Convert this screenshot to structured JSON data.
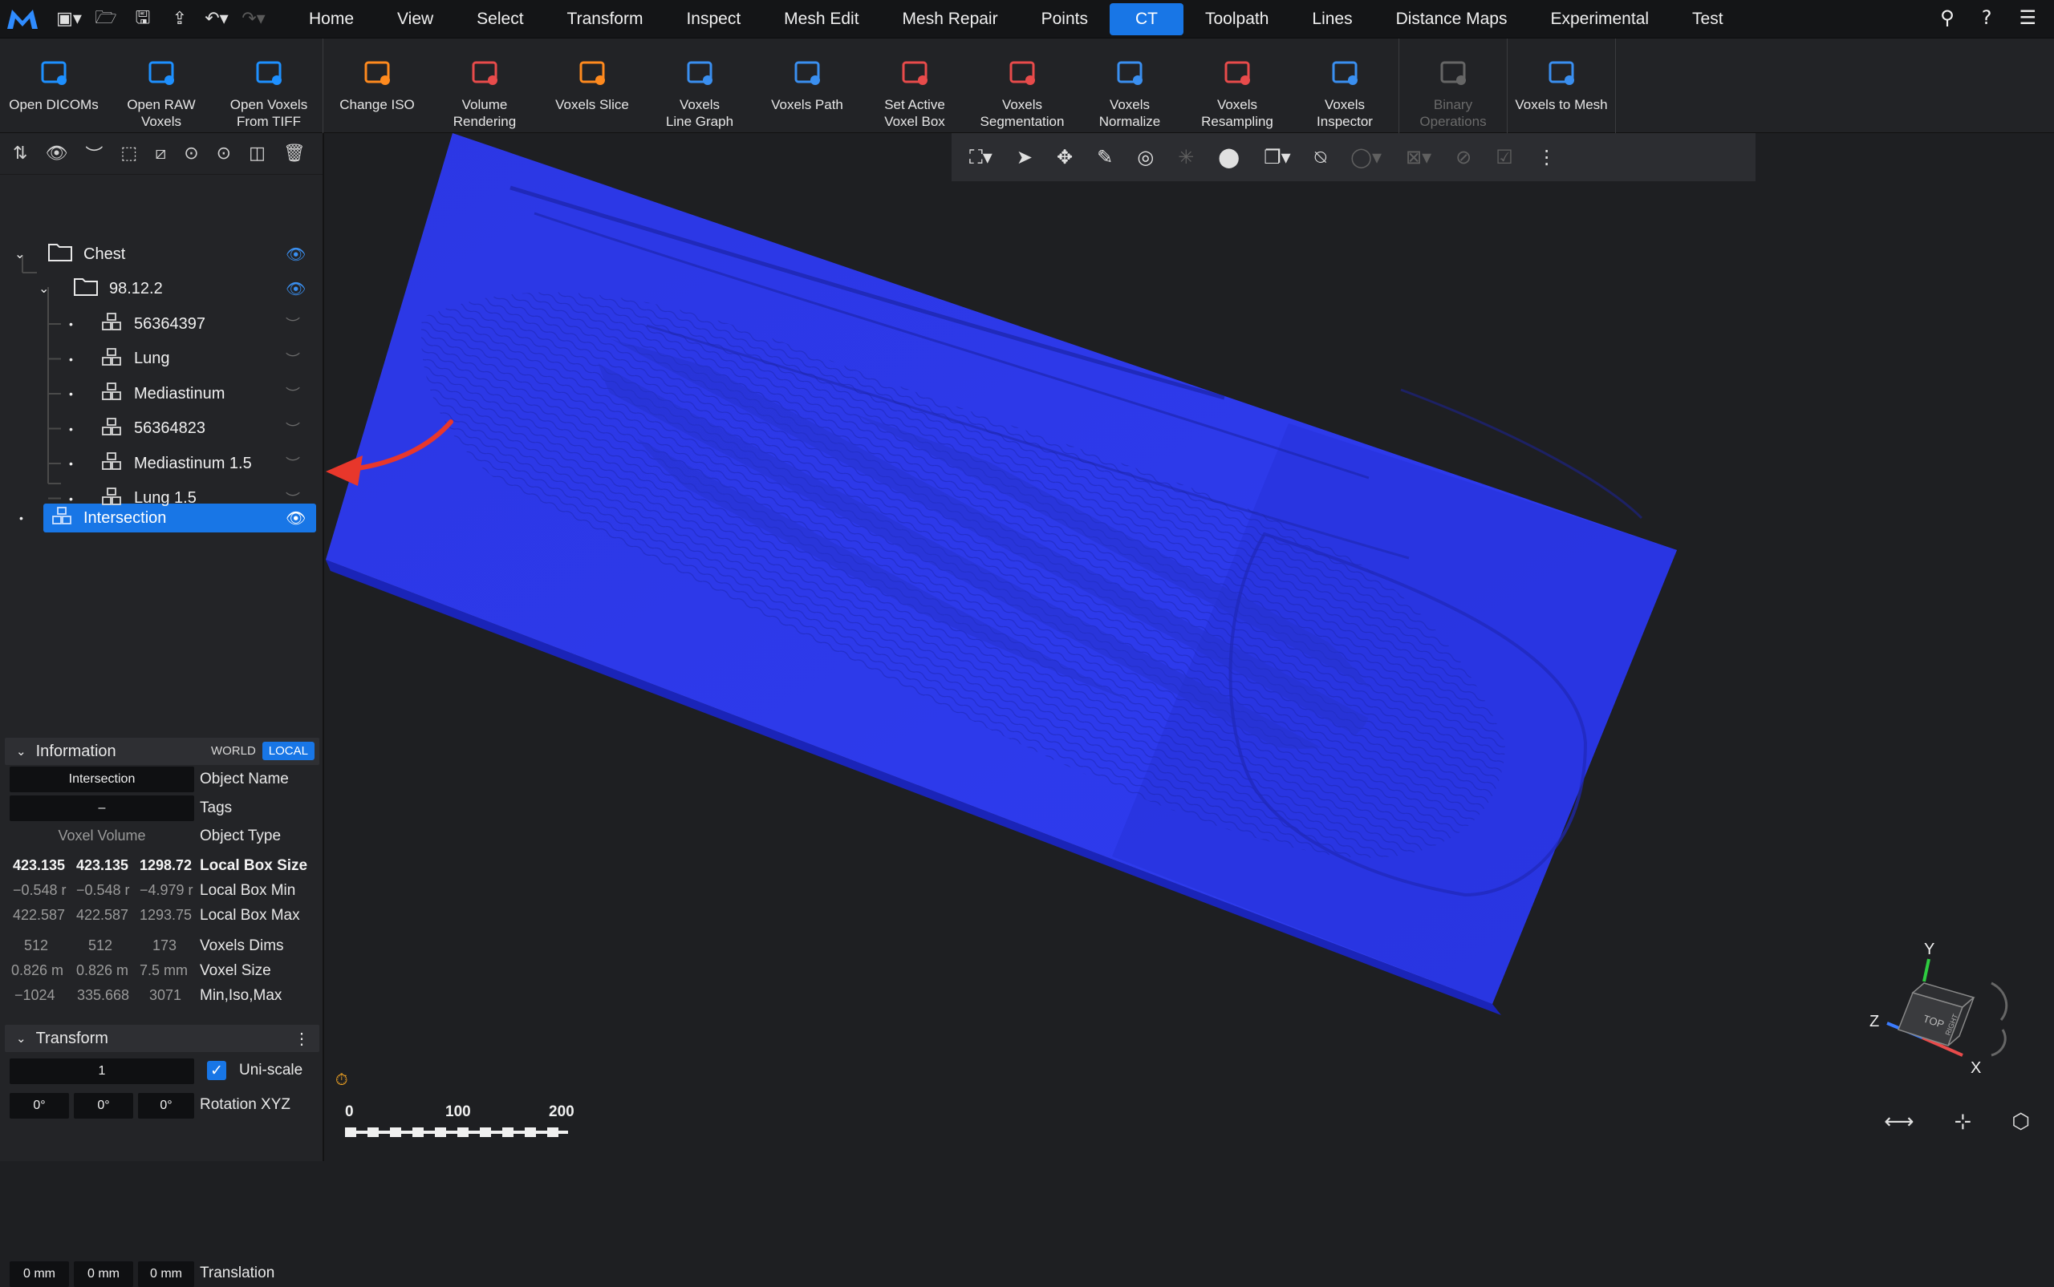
{
  "menu": [
    "Home",
    "View",
    "Select",
    "Transform",
    "Inspect",
    "Mesh Edit",
    "Mesh Repair",
    "Points",
    "CT",
    "Toolpath",
    "Lines",
    "Distance Maps",
    "Experimental",
    "Test"
  ],
  "menu_active": "CT",
  "ribbon": [
    {
      "label": "Open DICOMs",
      "icon": "open-dicoms-icon"
    },
    {
      "label": "Open RAW\nVoxels",
      "icon": "open-raw-voxels-icon"
    },
    {
      "label": "Open Voxels\nFrom TIFF",
      "icon": "open-tiff-icon"
    },
    {
      "label": "Change ISO",
      "icon": "change-iso-icon"
    },
    {
      "label": "Volume\nRendering",
      "icon": "volume-rendering-icon"
    },
    {
      "label": "Voxels Slice",
      "icon": "voxels-slice-icon"
    },
    {
      "label": "Voxels\nLine Graph",
      "icon": "line-graph-icon"
    },
    {
      "label": "Voxels Path",
      "icon": "voxels-path-icon"
    },
    {
      "label": "Set Active\nVoxel Box",
      "icon": "voxel-box-icon"
    },
    {
      "label": "Voxels\nSegmentation",
      "icon": "segmentation-icon"
    },
    {
      "label": "Voxels\nNormalize",
      "icon": "normalize-icon"
    },
    {
      "label": "Voxels\nResampling",
      "icon": "resampling-icon"
    },
    {
      "label": "Voxels\nInspector",
      "icon": "inspector-icon"
    },
    {
      "label": "Binary\nOperations",
      "icon": "binary-operations-icon"
    },
    {
      "label": "Voxels to Mesh",
      "icon": "voxels-to-mesh-icon"
    }
  ],
  "tree": {
    "root": "Chest",
    "folder": "98.12.2",
    "items": [
      "56364397",
      "Lung",
      "Mediastinum",
      "56364823",
      "Mediastinum 1.5",
      "Lung 1.5"
    ],
    "selected": "Intersection"
  },
  "info": {
    "title": "Information",
    "world": "WORLD",
    "local": "LOCAL",
    "object_name": "Intersection",
    "object_name_label": "Object Name",
    "tags": "–",
    "tags_label": "Tags",
    "object_type": "Voxel Volume",
    "object_type_label": "Object Type",
    "box_size": [
      "423.135",
      "423.135",
      "1298.72"
    ],
    "box_size_label": "Local Box Size",
    "box_min": [
      "−0.548 r",
      "−0.548 r",
      "−4.979 r"
    ],
    "box_min_label": "Local Box Min",
    "box_max": [
      "422.587",
      "422.587",
      "1293.75"
    ],
    "box_max_label": "Local Box Max",
    "dims": [
      "512",
      "512",
      "173"
    ],
    "dims_label": "Voxels Dims",
    "voxel_size": [
      "0.826 m",
      "0.826 m",
      "7.5 mm"
    ],
    "voxel_size_label": "Voxel Size",
    "min_iso_max": [
      "−1024",
      "335.668",
      "3071"
    ],
    "min_iso_max_label": "Min,Iso,Max"
  },
  "transform": {
    "title": "Transform",
    "scale": "1",
    "uniscale_label": "Uni-scale",
    "rotation": [
      "0°",
      "0°",
      "0°"
    ],
    "rotation_label": "Rotation XYZ",
    "translation": [
      "0 mm",
      "0 mm",
      "0 mm"
    ],
    "translation_label": "Translation"
  },
  "scale_bar": [
    "0",
    "100",
    "200"
  ],
  "axes": {
    "x": "X",
    "y": "Y",
    "z": "Z",
    "top": "TOP",
    "right": "RIGHT"
  },
  "colors": {
    "accent": "#1876e6",
    "volume": "#2b3be8",
    "arrow": "#e8372b"
  }
}
